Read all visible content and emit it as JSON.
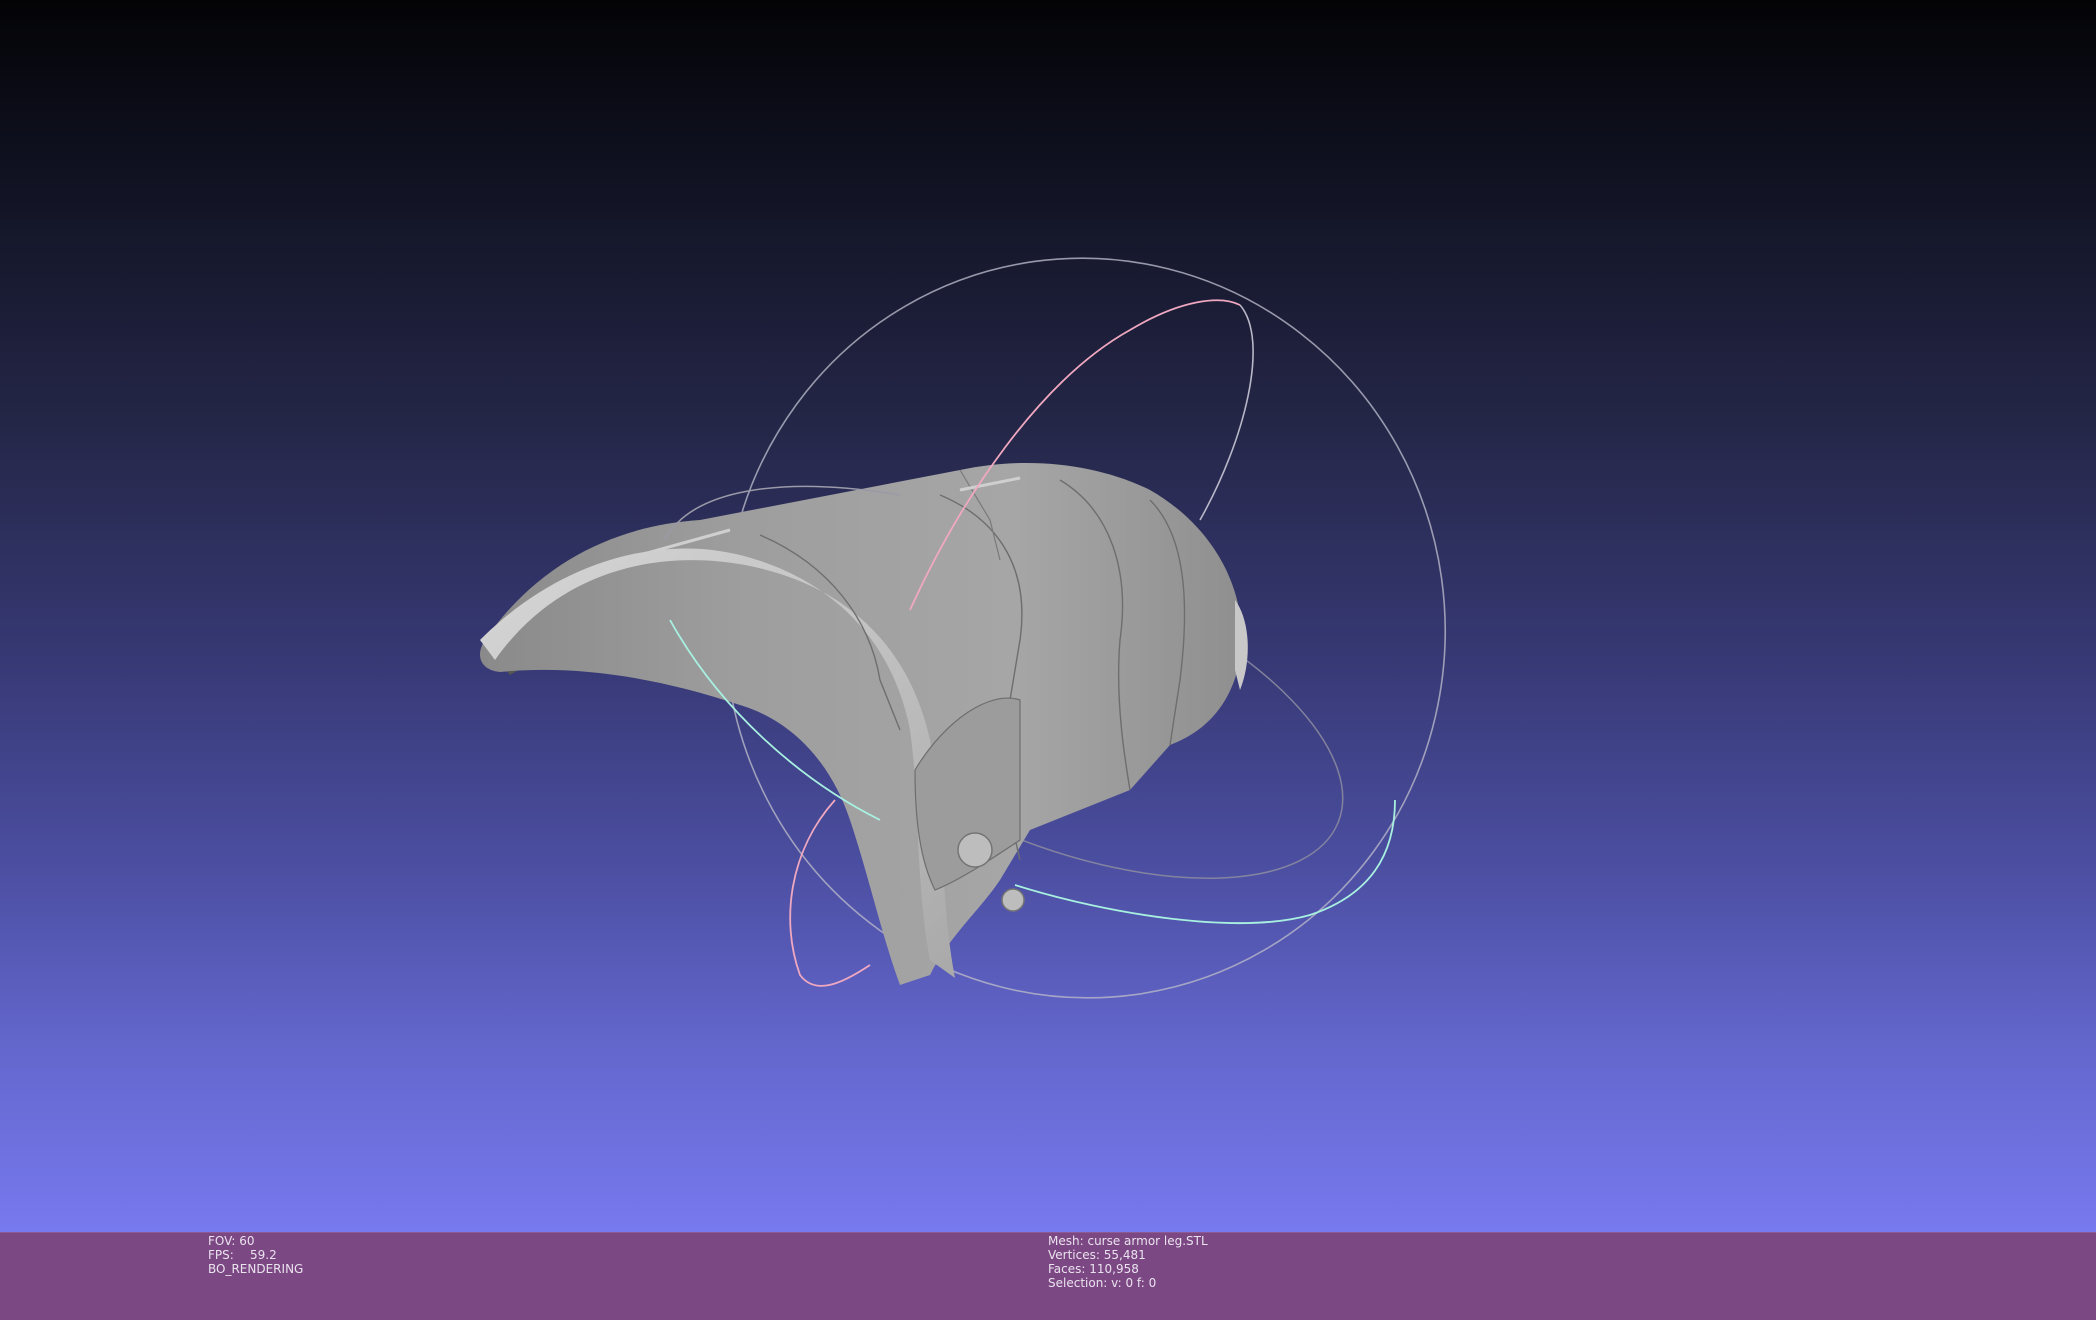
{
  "render_info": {
    "fov_label": "FOV:",
    "fov_value": "60",
    "fps_label": "FPS:",
    "fps_value": "59.2",
    "render_mode": "BO_RENDERING"
  },
  "mesh_info": {
    "mesh_label": "Mesh:",
    "mesh_name": "curse armor leg.STL",
    "vertices_label": "Vertices:",
    "vertices_value": "55,481",
    "faces_label": "Faces:",
    "faces_value": "110,958",
    "selection_label": "Selection:",
    "selection_value": "v: 0 f: 0"
  },
  "colors": {
    "infobar_background": "#7c4884",
    "viewport_top": "#030306",
    "viewport_bottom": "#7779ee",
    "mesh_gray": "#a7a7a7",
    "trackball_gray": "#9a9aa8",
    "trackball_pink": "#f0a8c0",
    "trackball_cyan": "#a8f0e0"
  },
  "icons": [
    "trackball-gizmo-icon"
  ]
}
